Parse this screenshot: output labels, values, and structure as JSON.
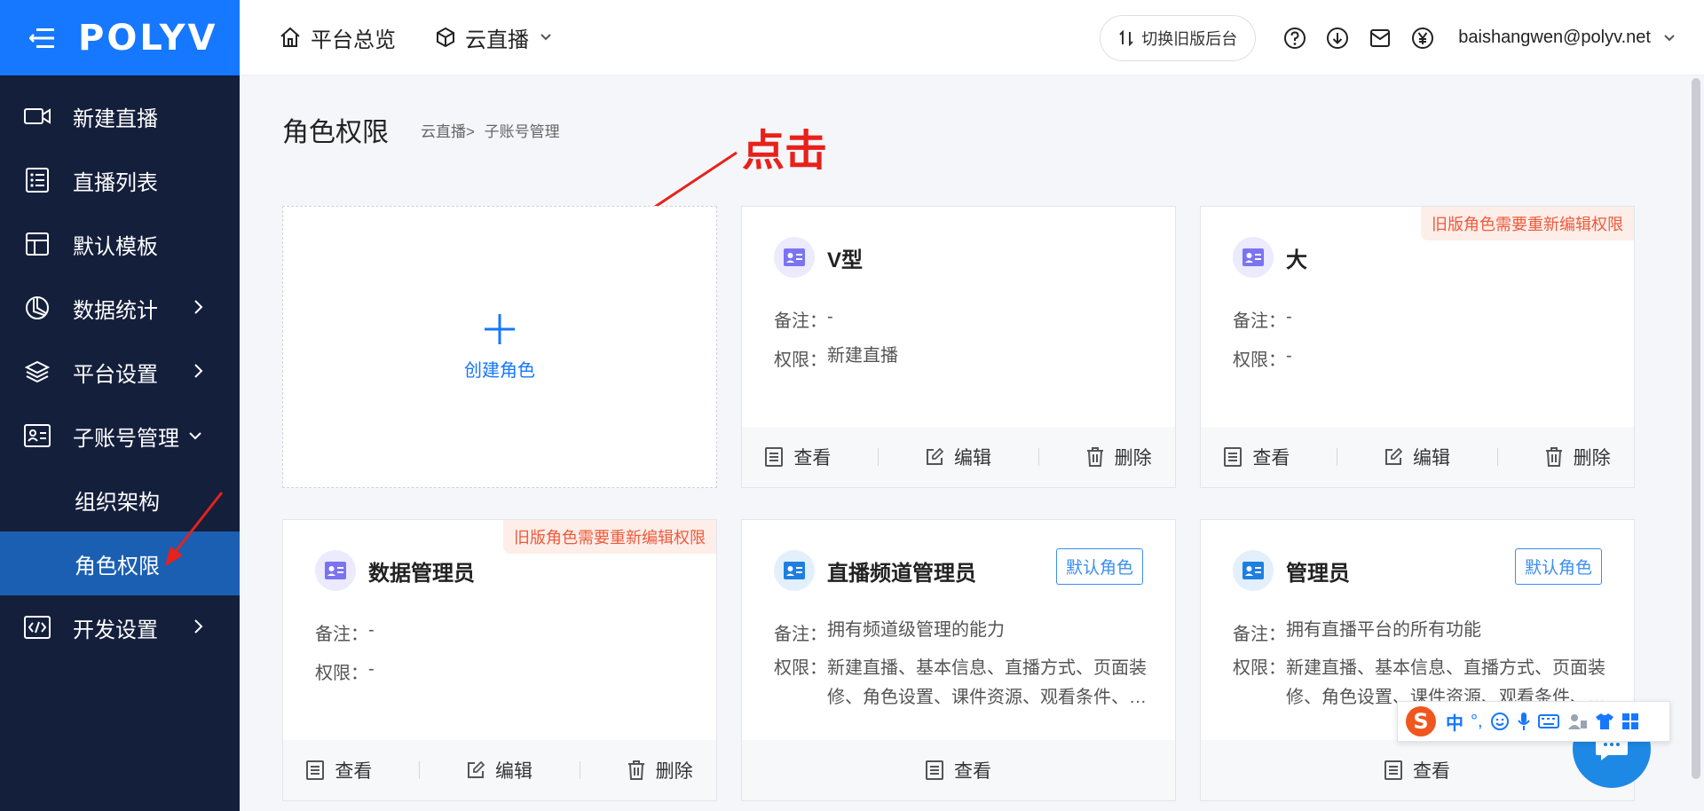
{
  "brand": {
    "logo_text": "POLYV",
    "accent": "#1677ff",
    "sidebar_bg": "#141f3c"
  },
  "sidebar": {
    "items": [
      {
        "label": "新建直播",
        "icon": "video-camera-icon"
      },
      {
        "label": "直播列表",
        "icon": "list-icon"
      },
      {
        "label": "默认模板",
        "icon": "template-layout-icon"
      },
      {
        "label": "数据统计",
        "icon": "pie-chart-icon",
        "expandable": true
      },
      {
        "label": "平台设置",
        "icon": "layers-icon",
        "expandable": true
      },
      {
        "label": "子账号管理",
        "icon": "id-card-icon",
        "expanded": true
      },
      {
        "label": "开发设置",
        "icon": "code-icon",
        "expandable": true
      }
    ],
    "subitems": [
      {
        "label": "组织架构"
      },
      {
        "label": "角色权限",
        "active": true
      }
    ]
  },
  "topbar": {
    "nav": [
      {
        "label": "平台总览",
        "icon": "home-icon"
      },
      {
        "label": "云直播",
        "icon": "cube-icon",
        "dropdown": true
      }
    ],
    "switch_label": "切换旧版后台",
    "tools": [
      "help-icon",
      "download-icon",
      "mail-icon",
      "yen-icon"
    ],
    "user_email": "baishangwen@polyv.net"
  },
  "page": {
    "title": "角色权限",
    "breadcrumb": [
      "云直播",
      ">",
      "子账号管理"
    ],
    "annotation": "点击",
    "create_label": "创建角色"
  },
  "labels": {
    "remark": "备注：",
    "permission": "权限：",
    "view": "查看",
    "edit": "编辑",
    "delete": "删除",
    "legacy_warning": "旧版角色需要重新编辑权限",
    "default_role": "默认角色"
  },
  "roles": [
    {
      "name": "V型",
      "remark": "-",
      "permission": "新建直播",
      "legacy": false,
      "default": false,
      "avatar_color": "#7b73f0"
    },
    {
      "name": "大",
      "remark": "-",
      "permission": "-",
      "legacy": true,
      "default": false,
      "avatar_color": "#7b73f0"
    },
    {
      "name": "数据管理员",
      "remark": "-",
      "permission": "-",
      "legacy": true,
      "default": false,
      "avatar_color": "#7b73f0"
    },
    {
      "name": "直播频道管理员",
      "remark": "拥有频道级管理的能力",
      "permission": "新建直播、基本信息、直播方式、页面装修、角色设置、课件资源、观看条件、数据统计",
      "legacy": false,
      "default": true,
      "avatar_color": "#1e7fe0"
    },
    {
      "name": "管理员",
      "remark": "拥有直播平台的所有功能",
      "permission": "新建直播、基本信息、直播方式、页面装修、角色设置、课件资源、观看条件、数据统计",
      "legacy": false,
      "default": true,
      "avatar_color": "#1e7fe0"
    }
  ],
  "ime": {
    "mode": "中",
    "punct": "°,"
  }
}
